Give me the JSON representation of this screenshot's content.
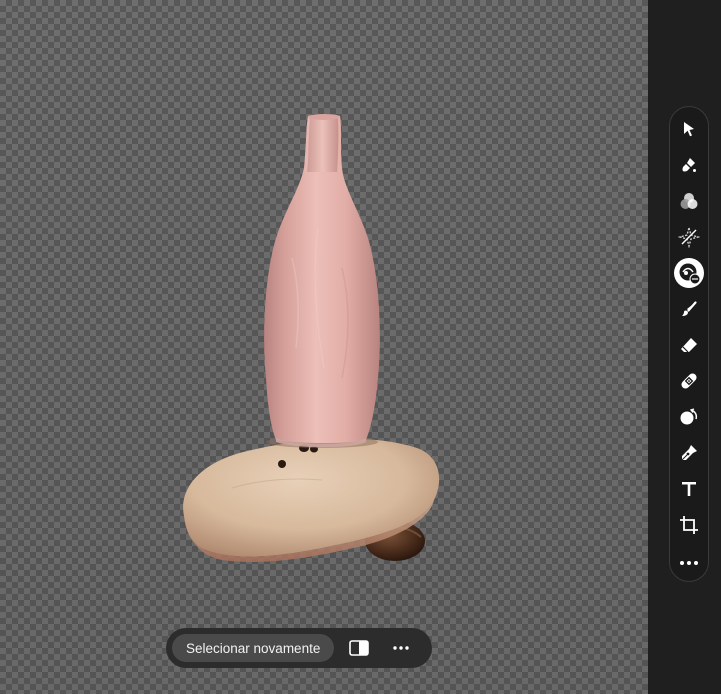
{
  "canvas": {
    "subject_icon": "vase-on-stone-cutout"
  },
  "toolbar": {
    "tools": [
      {
        "name": "select-tool",
        "icon": "arrow-pointer-icon"
      },
      {
        "name": "quick-select-tool",
        "icon": "brush-select-icon"
      },
      {
        "name": "adjustments-tool",
        "icon": "overlapping-circles-icon"
      },
      {
        "name": "generative-fill-tool",
        "icon": "sparkle-icon"
      },
      {
        "name": "remove-background-tool",
        "icon": "remove-object-icon",
        "active": true
      },
      {
        "name": "brush-tool",
        "icon": "brush-icon"
      },
      {
        "name": "eraser-tool",
        "icon": "eraser-icon"
      },
      {
        "name": "heal-tool",
        "icon": "bandage-icon"
      },
      {
        "name": "clone-tool",
        "icon": "clone-stamp-icon"
      },
      {
        "name": "pen-tool",
        "icon": "pen-icon"
      },
      {
        "name": "text-tool",
        "icon": "text-icon"
      },
      {
        "name": "crop-tool",
        "icon": "crop-icon"
      },
      {
        "name": "more-tools",
        "icon": "more-horizontal-icon"
      }
    ]
  },
  "selection_bar": {
    "reselect_label": "Selecionar novamente",
    "invert_icon": "invert-selection-icon",
    "more_icon": "more-horizontal-icon"
  },
  "colors": {
    "panel": "#1f1f1f",
    "button": "#4a4a4a",
    "accent_active": "#ffffff"
  }
}
